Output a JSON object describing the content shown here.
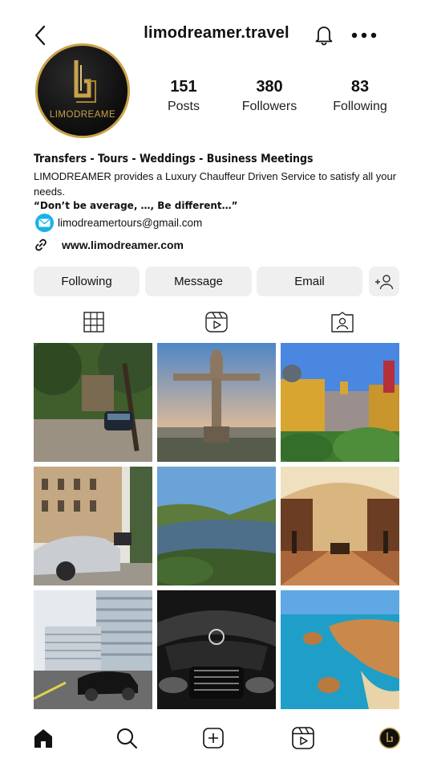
{
  "header": {
    "username": "limodreamer.travel",
    "back_icon": "chevron-left-icon",
    "bell_icon": "bell-icon",
    "more_icon": "more-horizontal-icon"
  },
  "avatar": {
    "brand_text": "LIMODREAME"
  },
  "stats": [
    {
      "value": "151",
      "label": "Posts"
    },
    {
      "value": "380",
      "label": "Followers"
    },
    {
      "value": "83",
      "label": "Following"
    }
  ],
  "bio": {
    "headline": "Transfers - Tours - Weddings - Business Meetings",
    "description": "LIMODREAMER provides a Luxury Chauffeur Driven Service to satisfy all your needs.",
    "quote": "“Don’t be average, …, Be different…”",
    "email": "limodreamertours@gmail.com",
    "website": "www.limodreamer.com"
  },
  "actions": {
    "following_label": "Following",
    "message_label": "Message",
    "email_label": "Email"
  },
  "tabs": [
    "posts-grid-icon",
    "reels-icon",
    "tagged-icon"
  ],
  "posts": [
    "garden-car",
    "christ-statue",
    "pena-palace",
    "hotel-car",
    "river-valley",
    "library-hall",
    "modern-building",
    "car-grille",
    "beach-cliffs"
  ],
  "nav": [
    "home-icon",
    "search-icon",
    "create-icon",
    "reels-icon",
    "profile-avatar"
  ],
  "colors": {
    "accent_gold": "#c9a24a",
    "button_bg": "#efefef",
    "mail_icon_bg": "#16b3e8"
  }
}
